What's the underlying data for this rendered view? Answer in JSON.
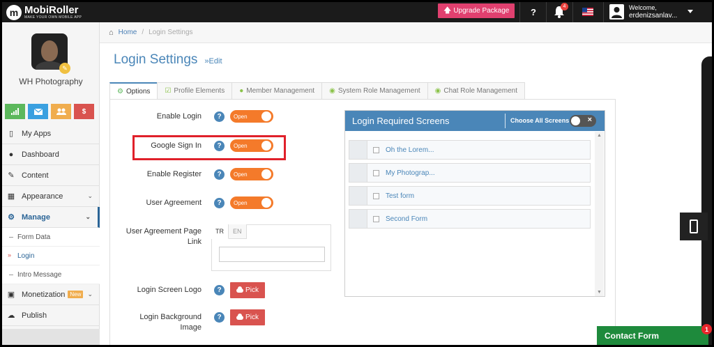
{
  "topbar": {
    "logo_name": "MobiRoller",
    "logo_tagline": "MAKE YOUR OWN MOBILE APP",
    "upgrade_label": "Upgrade Package",
    "help_label": "?",
    "notification_count": "4",
    "welcome_line1": "Welcome,",
    "welcome_line2": "erdenizsanlav..."
  },
  "sidebar": {
    "app_name": "WH Photography",
    "quick_icons": [
      "stats-icon",
      "mail-icon",
      "users-icon",
      "dollar-icon"
    ],
    "dollar_glyph": "$",
    "items": [
      {
        "label": "My Apps",
        "icon": "mobile-icon"
      },
      {
        "label": "Dashboard",
        "icon": "dashboard-icon"
      },
      {
        "label": "Content",
        "icon": "edit-icon"
      },
      {
        "label": "Appearance",
        "icon": "grid-icon"
      },
      {
        "label": "Manage",
        "icon": "cogs-icon"
      }
    ],
    "sub_items": [
      {
        "label": "Form Data"
      },
      {
        "label": "Login"
      },
      {
        "label": "Intro Message"
      }
    ],
    "monetization_label": "Monetization",
    "monetization_badge": "New",
    "publish_label": "Publish"
  },
  "breadcrumb": {
    "home": "Home",
    "current": "Login Settings"
  },
  "page": {
    "title": "Login Settings",
    "edit_label": "»Edit"
  },
  "tabs": [
    {
      "label": "Options",
      "icon": "gear-icon"
    },
    {
      "label": "Profile Elements",
      "icon": "check-square-icon"
    },
    {
      "label": "Member Management",
      "icon": "users-icon"
    },
    {
      "label": "System Role Management",
      "icon": "eye-icon"
    },
    {
      "label": "Chat Role Management",
      "icon": "chat-icon"
    }
  ],
  "form": {
    "enable_login": {
      "label": "Enable Login",
      "state": "Open"
    },
    "google_sign_in": {
      "label": "Google Sign In",
      "state": "Open"
    },
    "enable_register": {
      "label": "Enable Register",
      "state": "Open"
    },
    "user_agreement": {
      "label": "User Agreement",
      "state": "Open"
    },
    "user_agreement_link": {
      "label": "User Agreement Page Link",
      "lang_tabs": [
        "TR",
        "EN"
      ],
      "value": ""
    },
    "login_screen_logo": {
      "label": "Login Screen Logo",
      "button": "Pick"
    },
    "login_background_image": {
      "label": "Login Background Image",
      "button": "Pick"
    }
  },
  "login_required": {
    "title": "Login Required Screens",
    "choose_all_label": "Choose All Screens",
    "screens": [
      "Oh the Lorem...",
      "My Photograp...",
      "Test form",
      "Second Form"
    ]
  },
  "contact_form": {
    "label": "Contact Form",
    "badge": "1"
  },
  "colors": {
    "topbar": "#1b1b1b",
    "accent_blue": "#4a86b8",
    "toggle_orange": "#f47a2a",
    "pick_red": "#d9534f",
    "upgrade_pink": "#e0406f",
    "contact_green": "#1e8a3c",
    "highlight_red": "#e0202a"
  }
}
